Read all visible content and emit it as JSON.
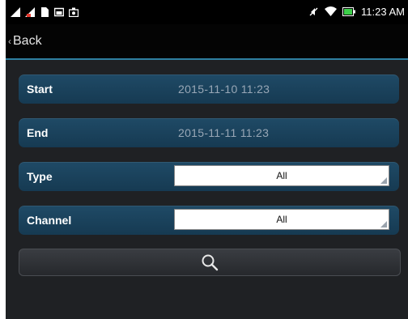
{
  "status_bar": {
    "left_icons": [
      "signal-icon",
      "warning-signal-icon",
      "document-icon",
      "gallery-icon",
      "camera-icon"
    ],
    "right_icons": [
      "muted-icon",
      "wifi-icon",
      "battery-icon"
    ],
    "time": "11:23 AM"
  },
  "nav": {
    "back_label": "Back"
  },
  "form": {
    "start": {
      "label": "Start",
      "value": "2015-11-10 11:23"
    },
    "end": {
      "label": "End",
      "value": "2015-11-11 11:23"
    },
    "type": {
      "label": "Type",
      "value": "All"
    },
    "channel": {
      "label": "Channel",
      "value": "All"
    }
  },
  "colors": {
    "accent": "#2e7fa1",
    "row_bg": "#1f4a66",
    "battery": "#3dcf4a"
  }
}
